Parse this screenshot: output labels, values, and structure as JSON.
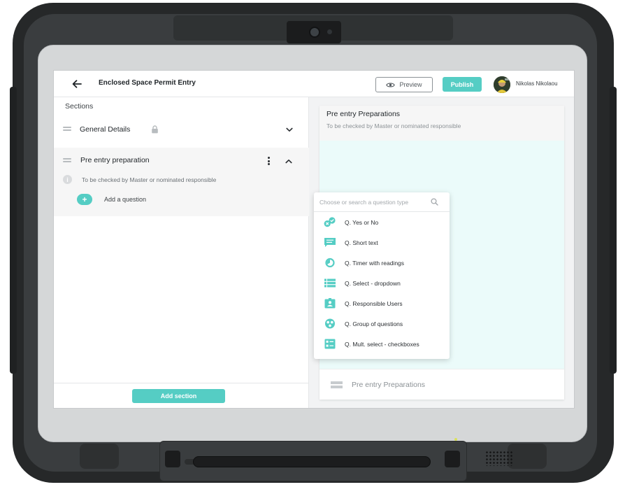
{
  "header": {
    "title": "Enclosed Space Permit Entry",
    "preview_label": "Preview",
    "publish_label": "Publish",
    "user_name": "Nikolas Nikolaou"
  },
  "left_panel": {
    "sections_label": "Sections",
    "sections": [
      {
        "title": "General Details",
        "locked": true,
        "expanded": false
      },
      {
        "title": "Pre entry preparation",
        "expanded": true,
        "info": "To be checked by Master or nominated responsible",
        "add_question_label": "Add a question"
      }
    ],
    "add_section_label": "Add section"
  },
  "right_panel": {
    "title": "Pre entry Preparations",
    "subtitle": "To be checked by Master or nominated responsible",
    "footer_label": "Pre entry Preparations"
  },
  "question_menu": {
    "search_placeholder": "Choose or search a question type",
    "items": [
      {
        "label": "Q. Yes or No",
        "icon": "yes-no-icon"
      },
      {
        "label": "Q. Short text",
        "icon": "short-text-icon"
      },
      {
        "label": "Q. Timer with readings",
        "icon": "timer-icon"
      },
      {
        "label": "Q. Select - dropdown",
        "icon": "dropdown-list-icon"
      },
      {
        "label": "Q. Responsible Users",
        "icon": "user-badge-icon"
      },
      {
        "label": "Q. Group of questions",
        "icon": "group-icon"
      },
      {
        "label": "Q. Mult. select - checkboxes",
        "icon": "checkbox-list-icon"
      }
    ]
  },
  "colors": {
    "accent": "#55cdc4",
    "mint_background": "#ebfbfa",
    "frame": "#262829"
  }
}
